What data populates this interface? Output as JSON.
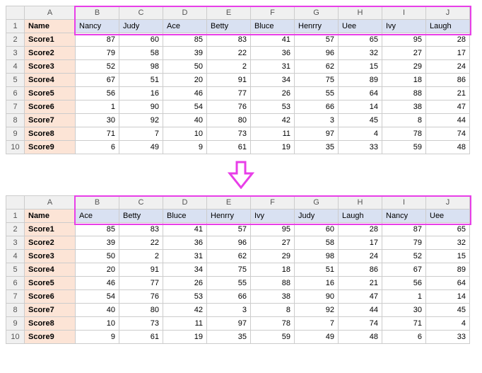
{
  "columns": [
    "",
    "A",
    "B",
    "C",
    "D",
    "E",
    "F",
    "G",
    "H",
    "I",
    "J"
  ],
  "row_labels": [
    "Name",
    "Score1",
    "Score2",
    "Score3",
    "Score4",
    "Score5",
    "Score6",
    "Score7",
    "Score8",
    "Score9"
  ],
  "before": {
    "names": [
      "Nancy",
      "Judy",
      "Ace",
      "Betty",
      "Bluce",
      "Henrry",
      "Uee",
      "Ivy",
      "Laugh"
    ],
    "data": [
      [
        87,
        60,
        85,
        83,
        41,
        57,
        65,
        95,
        28
      ],
      [
        79,
        58,
        39,
        22,
        36,
        96,
        32,
        27,
        17
      ],
      [
        52,
        98,
        50,
        2,
        31,
        62,
        15,
        29,
        24
      ],
      [
        67,
        51,
        20,
        91,
        34,
        75,
        89,
        18,
        86
      ],
      [
        56,
        16,
        46,
        77,
        26,
        55,
        64,
        88,
        21
      ],
      [
        1,
        90,
        54,
        76,
        53,
        66,
        14,
        38,
        47
      ],
      [
        30,
        92,
        40,
        80,
        42,
        3,
        45,
        8,
        44
      ],
      [
        71,
        7,
        10,
        73,
        11,
        97,
        4,
        78,
        74
      ],
      [
        6,
        49,
        9,
        61,
        19,
        35,
        33,
        59,
        48
      ]
    ]
  },
  "after": {
    "names": [
      "Ace",
      "Betty",
      "Bluce",
      "Henrry",
      "Ivy",
      "Judy",
      "Laugh",
      "Nancy",
      "Uee"
    ],
    "data": [
      [
        85,
        83,
        41,
        57,
        95,
        60,
        28,
        87,
        65
      ],
      [
        39,
        22,
        36,
        96,
        27,
        58,
        17,
        79,
        32
      ],
      [
        50,
        2,
        31,
        62,
        29,
        98,
        24,
        52,
        15
      ],
      [
        20,
        91,
        34,
        75,
        18,
        51,
        86,
        67,
        89
      ],
      [
        46,
        77,
        26,
        55,
        88,
        16,
        21,
        56,
        64
      ],
      [
        54,
        76,
        53,
        66,
        38,
        90,
        47,
        1,
        14
      ],
      [
        40,
        80,
        42,
        3,
        8,
        92,
        44,
        30,
        45
      ],
      [
        10,
        73,
        11,
        97,
        78,
        7,
        74,
        71,
        4
      ],
      [
        9,
        61,
        19,
        35,
        59,
        49,
        48,
        6,
        33
      ]
    ]
  },
  "chart_data": [
    {
      "type": "table",
      "title": "Before sort",
      "columns": [
        "Nancy",
        "Judy",
        "Ace",
        "Betty",
        "Bluce",
        "Henrry",
        "Uee",
        "Ivy",
        "Laugh"
      ],
      "rows": [
        "Score1",
        "Score2",
        "Score3",
        "Score4",
        "Score5",
        "Score6",
        "Score7",
        "Score8",
        "Score9"
      ],
      "values": [
        [
          87,
          60,
          85,
          83,
          41,
          57,
          65,
          95,
          28
        ],
        [
          79,
          58,
          39,
          22,
          36,
          96,
          32,
          27,
          17
        ],
        [
          52,
          98,
          50,
          2,
          31,
          62,
          15,
          29,
          24
        ],
        [
          67,
          51,
          20,
          91,
          34,
          75,
          89,
          18,
          86
        ],
        [
          56,
          16,
          46,
          77,
          26,
          55,
          64,
          88,
          21
        ],
        [
          1,
          90,
          54,
          76,
          53,
          66,
          14,
          38,
          47
        ],
        [
          30,
          92,
          40,
          80,
          42,
          3,
          45,
          8,
          44
        ],
        [
          71,
          7,
          10,
          73,
          11,
          97,
          4,
          78,
          74
        ],
        [
          6,
          49,
          9,
          61,
          19,
          35,
          33,
          59,
          48
        ]
      ]
    },
    {
      "type": "table",
      "title": "After sort (columns alphabetical by name)",
      "columns": [
        "Ace",
        "Betty",
        "Bluce",
        "Henrry",
        "Ivy",
        "Judy",
        "Laugh",
        "Nancy",
        "Uee"
      ],
      "rows": [
        "Score1",
        "Score2",
        "Score3",
        "Score4",
        "Score5",
        "Score6",
        "Score7",
        "Score8",
        "Score9"
      ],
      "values": [
        [
          85,
          83,
          41,
          57,
          95,
          60,
          28,
          87,
          65
        ],
        [
          39,
          22,
          36,
          96,
          27,
          58,
          17,
          79,
          32
        ],
        [
          50,
          2,
          31,
          62,
          29,
          98,
          24,
          52,
          15
        ],
        [
          20,
          91,
          34,
          75,
          18,
          51,
          86,
          67,
          89
        ],
        [
          46,
          77,
          26,
          55,
          88,
          16,
          21,
          56,
          64
        ],
        [
          54,
          76,
          53,
          66,
          38,
          90,
          47,
          1,
          14
        ],
        [
          40,
          80,
          42,
          3,
          8,
          92,
          44,
          30,
          45
        ],
        [
          10,
          73,
          11,
          97,
          78,
          7,
          74,
          71,
          4
        ],
        [
          9,
          61,
          19,
          35,
          59,
          49,
          48,
          6,
          33
        ]
      ]
    }
  ]
}
